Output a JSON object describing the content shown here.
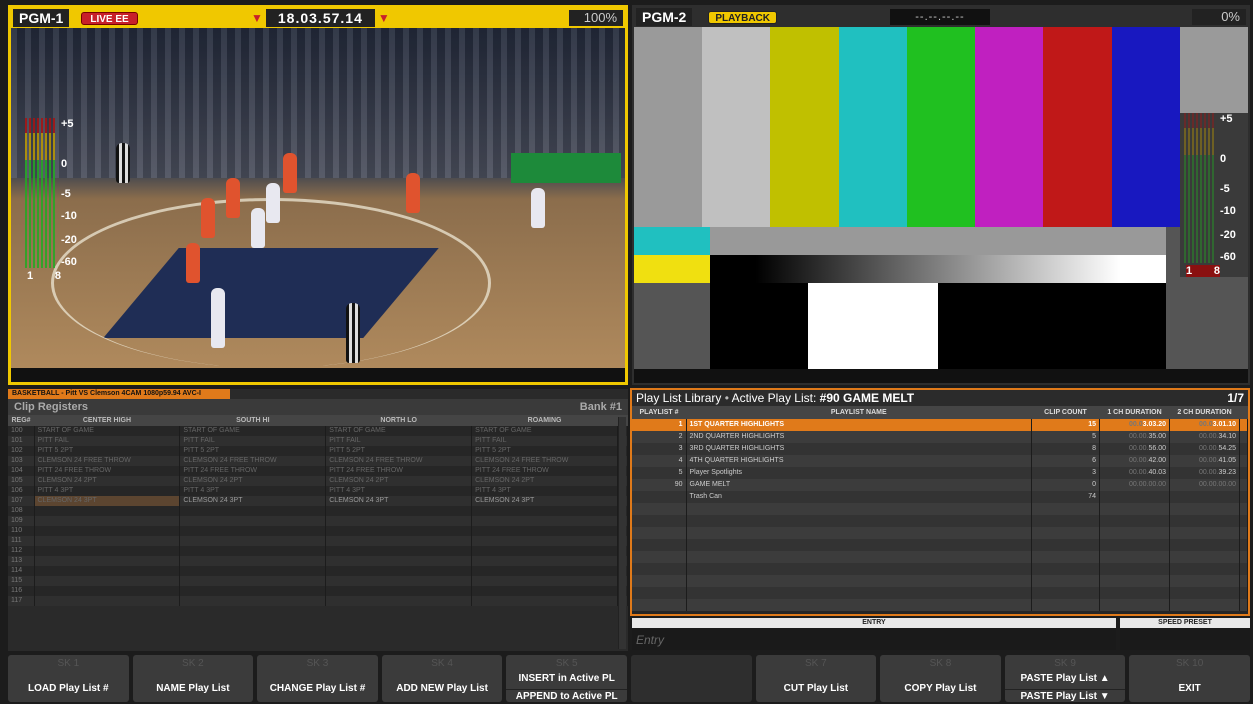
{
  "pgm1": {
    "label": "PGM-1",
    "badge": "LIVE EE",
    "timecode": "18.03.57.14",
    "percent": "100%",
    "meter_scale": [
      "+5",
      "0",
      "-5",
      "-10",
      "-20",
      "-60"
    ],
    "meter_channels": [
      "1",
      "8"
    ]
  },
  "pgm2": {
    "label": "PGM-2",
    "badge": "PLAYBACK",
    "timecode": "--.--.--.--",
    "percent": "0%",
    "meter_scale": [
      "+5",
      "0",
      "-5",
      "-10",
      "-20",
      "-60"
    ],
    "meter_channels": [
      "1",
      "8"
    ],
    "color_bars": [
      "#9a9a9a",
      "#c0c0c0",
      "#c0c000",
      "#20c0c0",
      "#20c020",
      "#c020c0",
      "#c01818",
      "#1818c0",
      "#9a9a9a"
    ]
  },
  "clip": {
    "source_tab": "BASKETBALL - Pitt VS Clemson 4CAM 1080p59.94 AVC-I",
    "title": "Clip Registers",
    "bank": "Bank #1",
    "columns": [
      "REG#",
      "CENTER HIGH",
      "SOUTH HI",
      "NORTH LO",
      "ROAMING"
    ],
    "rows": [
      [
        "100",
        "START OF GAME",
        "START OF GAME",
        "START OF GAME",
        "START OF GAME"
      ],
      [
        "101",
        "PITT FAIL",
        "PITT FAIL",
        "PITT FAIL",
        "PITT FAIL"
      ],
      [
        "102",
        "PITT 5 2PT",
        "PITT 5 2PT",
        "PITT 5 2PT",
        "PITT 5 2PT"
      ],
      [
        "103",
        "CLEMSON 24 FREE THROW",
        "CLEMSON 24 FREE THROW",
        "CLEMSON 24 FREE THROW",
        "CLEMSON 24 FREE THROW"
      ],
      [
        "104",
        "PITT 24 FREE THROW",
        "PITT 24 FREE THROW",
        "PITT 24 FREE THROW",
        "PITT 24 FREE THROW"
      ],
      [
        "105",
        "CLEMSON 24 2PT",
        "CLEMSON 24 2PT",
        "CLEMSON 24 2PT",
        "CLEMSON 24 2PT"
      ],
      [
        "106",
        "PITT 4 3PT",
        "PITT 4 3PT",
        "PITT 4 3PT",
        "PITT 4 3PT"
      ],
      [
        "107",
        "CLEMSON 24 3PT",
        "CLEMSON 24 3PT",
        "CLEMSON 24 3PT",
        "CLEMSON 24 3PT"
      ],
      [
        "108",
        "",
        "",
        "",
        ""
      ],
      [
        "109",
        "",
        "",
        "",
        ""
      ],
      [
        "110",
        "",
        "",
        "",
        ""
      ],
      [
        "111",
        "",
        "",
        "",
        ""
      ],
      [
        "112",
        "",
        "",
        "",
        ""
      ],
      [
        "113",
        "",
        "",
        "",
        ""
      ],
      [
        "114",
        "",
        "",
        "",
        ""
      ],
      [
        "115",
        "",
        "",
        "",
        ""
      ],
      [
        "116",
        "",
        "",
        "",
        ""
      ],
      [
        "117",
        "",
        "",
        "",
        ""
      ]
    ]
  },
  "playlist": {
    "title": "Play List Library",
    "active_label": "Active Play List:",
    "active_name": "#90 GAME MELT",
    "page": "1/7",
    "columns": [
      "PLAYLIST #",
      "PLAYLIST NAME",
      "CLIP COUNT",
      "1 CH DURATION",
      "2 CH DURATION"
    ],
    "rows": [
      {
        "num": "1",
        "name": "1ST QUARTER HIGHLIGHTS",
        "count": "15",
        "d1_dim": "00.0",
        "d1": "3.03.20",
        "d2_dim": "00.0",
        "d2": "3.01.10"
      },
      {
        "num": "2",
        "name": "2ND QUARTER HIGHLIGHTS",
        "count": "5",
        "d1_dim": "00.00.",
        "d1": "35.00",
        "d2_dim": "00.00.",
        "d2": "34.10"
      },
      {
        "num": "3",
        "name": "3RD QUARTER HIGHLIGHTS",
        "count": "8",
        "d1_dim": "00.00.",
        "d1": "56.00",
        "d2_dim": "00.00.",
        "d2": "54.25"
      },
      {
        "num": "4",
        "name": "4TH QUARTER HIGHLIGHTS",
        "count": "6",
        "d1_dim": "00.00.",
        "d1": "42.00",
        "d2_dim": "00.00.",
        "d2": "41.05"
      },
      {
        "num": "5",
        "name": "Player Spotlights",
        "count": "3",
        "d1_dim": "00.00.",
        "d1": "40.03",
        "d2_dim": "00.00.",
        "d2": "39.23"
      },
      {
        "num": "90",
        "name": "GAME MELT",
        "count": "0",
        "d1_dim": "00.00.00.00",
        "d1": "",
        "d2_dim": "00.00.00.00",
        "d2": ""
      },
      {
        "num": "",
        "name": "Trash Can",
        "count": "74",
        "d1_dim": "",
        "d1": "",
        "d2_dim": "",
        "d2": ""
      }
    ]
  },
  "entry": {
    "header": "ENTRY",
    "placeholder": "Entry"
  },
  "speed": {
    "header": "SPEED PRESET"
  },
  "softkeys": [
    {
      "key": "SK 1",
      "label": "LOAD Play List #"
    },
    {
      "key": "SK 2",
      "label": "NAME Play List"
    },
    {
      "key": "SK 3",
      "label": "CHANGE Play List #"
    },
    {
      "key": "SK 4",
      "label": "ADD NEW Play List"
    },
    {
      "key": "SK 5",
      "label1": "INSERT in Active PL",
      "label2": "APPEND to Active PL"
    },
    {
      "key": "",
      "label": ""
    },
    {
      "key": "SK 7",
      "label": "CUT Play List"
    },
    {
      "key": "SK 8",
      "label": "COPY Play List"
    },
    {
      "key": "SK 9",
      "label1": "PASTE Play List ▲",
      "label2": "PASTE Play List ▼"
    },
    {
      "key": "SK 10",
      "label": "EXIT"
    }
  ]
}
